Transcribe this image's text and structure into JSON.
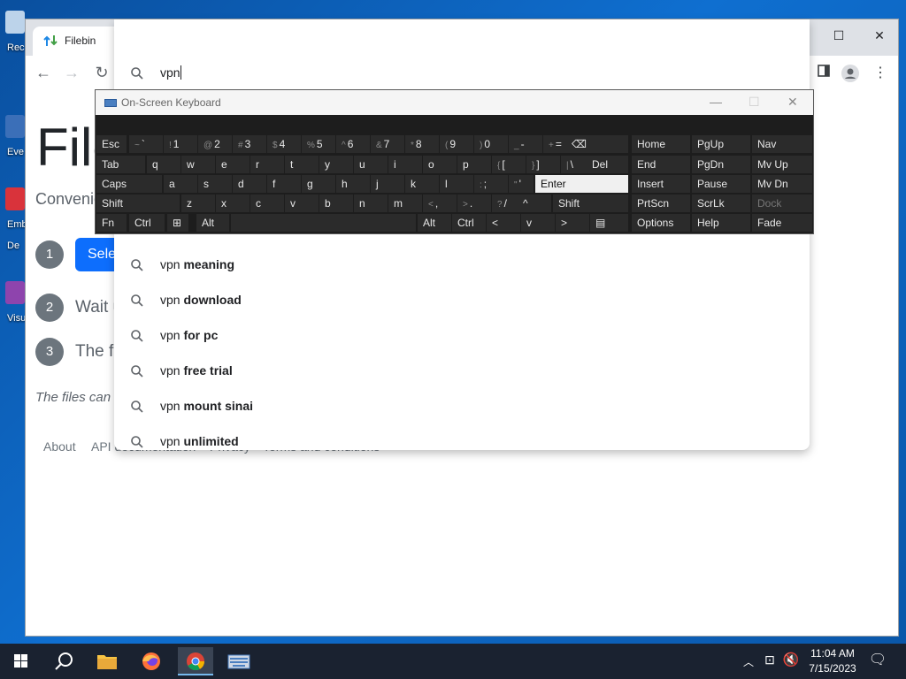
{
  "desktop": {
    "icons": [
      {
        "label": "Rec",
        "color": "#bcd3ea"
      },
      {
        "label": "Eve",
        "color": "#3b6fb8"
      },
      {
        "label": "Emb",
        "color": "#d9333b"
      },
      {
        "label": "Visu",
        "color": "#8e44ad"
      }
    ],
    "icon_extra_label": "De"
  },
  "browser": {
    "tab_title": "Filebin",
    "new_tab": "+",
    "window_controls": {
      "dropdown": "⌄",
      "minimize": "—",
      "maximize": "☐",
      "close": "✕"
    },
    "omnibox_query": "vpn",
    "suggestions": [
      {
        "base": "vpn",
        "bold": "meaning"
      },
      {
        "base": "vpn",
        "bold": "download"
      },
      {
        "base": "vpn",
        "bold": "for pc"
      },
      {
        "base": "vpn",
        "bold": "free trial"
      },
      {
        "base": "vpn",
        "bold": "mount sinai"
      },
      {
        "base": "vpn",
        "bold": "unlimited"
      }
    ]
  },
  "page": {
    "logo": "Filebin",
    "subtitle": "Convenient file sharing",
    "steps": [
      {
        "num": "1",
        "button": "Select files to upload"
      },
      {
        "num": "2",
        "text": "Wait until the upload completes"
      },
      {
        "num": "3",
        "text": "The files can be shared"
      }
    ],
    "note": "The files can be downloaded",
    "footer": [
      "About",
      "API documentation",
      "Privacy",
      "Terms and conditions"
    ]
  },
  "osk": {
    "title": "On-Screen Keyboard",
    "row1": [
      {
        "k": "Esc"
      },
      {
        "s": "~",
        "k": "`"
      },
      {
        "s": "!",
        "k": "1"
      },
      {
        "s": "@",
        "k": "2"
      },
      {
        "s": "#",
        "k": "3"
      },
      {
        "s": "$",
        "k": "4"
      },
      {
        "s": "%",
        "k": "5"
      },
      {
        "s": "^",
        "k": "6"
      },
      {
        "s": "&",
        "k": "7"
      },
      {
        "s": "*",
        "k": "8"
      },
      {
        "s": "(",
        "k": "9"
      },
      {
        "s": ")",
        "k": "0"
      },
      {
        "s": "_",
        "k": "-"
      },
      {
        "s": "+",
        "k": "="
      },
      {
        "k": "⌫"
      }
    ],
    "row2": [
      {
        "k": "Tab"
      },
      {
        "k": "q"
      },
      {
        "k": "w"
      },
      {
        "k": "e"
      },
      {
        "k": "r"
      },
      {
        "k": "t"
      },
      {
        "k": "y"
      },
      {
        "k": "u"
      },
      {
        "k": "i"
      },
      {
        "k": "o"
      },
      {
        "k": "p"
      },
      {
        "s": "{",
        "k": "["
      },
      {
        "s": "}",
        "k": "]"
      },
      {
        "s": "|",
        "k": "\\"
      },
      {
        "k": "Del"
      }
    ],
    "row3": [
      {
        "k": "Caps"
      },
      {
        "k": "a"
      },
      {
        "k": "s"
      },
      {
        "k": "d"
      },
      {
        "k": "f"
      },
      {
        "k": "g"
      },
      {
        "k": "h"
      },
      {
        "k": "j"
      },
      {
        "k": "k"
      },
      {
        "k": "l"
      },
      {
        "s": ":",
        "k": ";"
      },
      {
        "s": "\"",
        "k": "'"
      },
      {
        "k": "Enter"
      }
    ],
    "row4": [
      {
        "k": "Shift"
      },
      {
        "k": "z"
      },
      {
        "k": "x"
      },
      {
        "k": "c"
      },
      {
        "k": "v"
      },
      {
        "k": "b"
      },
      {
        "k": "n"
      },
      {
        "k": "m"
      },
      {
        "s": "<",
        "k": ","
      },
      {
        "s": ">",
        "k": "."
      },
      {
        "s": "?",
        "k": "/"
      },
      {
        "k": "^"
      },
      {
        "k": "Shift"
      }
    ],
    "row5": [
      {
        "k": "Fn"
      },
      {
        "k": "Ctrl"
      },
      {
        "k": "⊞"
      },
      {
        "k": "Alt"
      },
      {
        "k": ""
      },
      {
        "k": "Alt"
      },
      {
        "k": "Ctrl"
      },
      {
        "k": "<"
      },
      {
        "k": "v"
      },
      {
        "k": ">"
      },
      {
        "k": "▤"
      }
    ],
    "nav_rows": [
      [
        "Home",
        "PgUp",
        "Nav"
      ],
      [
        "End",
        "PgDn",
        "Mv Up"
      ],
      [
        "Insert",
        "Pause",
        "Mv Dn"
      ],
      [
        "PrtScn",
        "ScrLk",
        "Dock"
      ],
      [
        "Options",
        "Help",
        "Fade"
      ]
    ]
  },
  "taskbar": {
    "time": "11:04 AM",
    "date": "7/15/2023"
  },
  "colors": {
    "accent": "#0d6efd",
    "desktop": "#0d63b8",
    "taskbar": "#1a2230"
  }
}
